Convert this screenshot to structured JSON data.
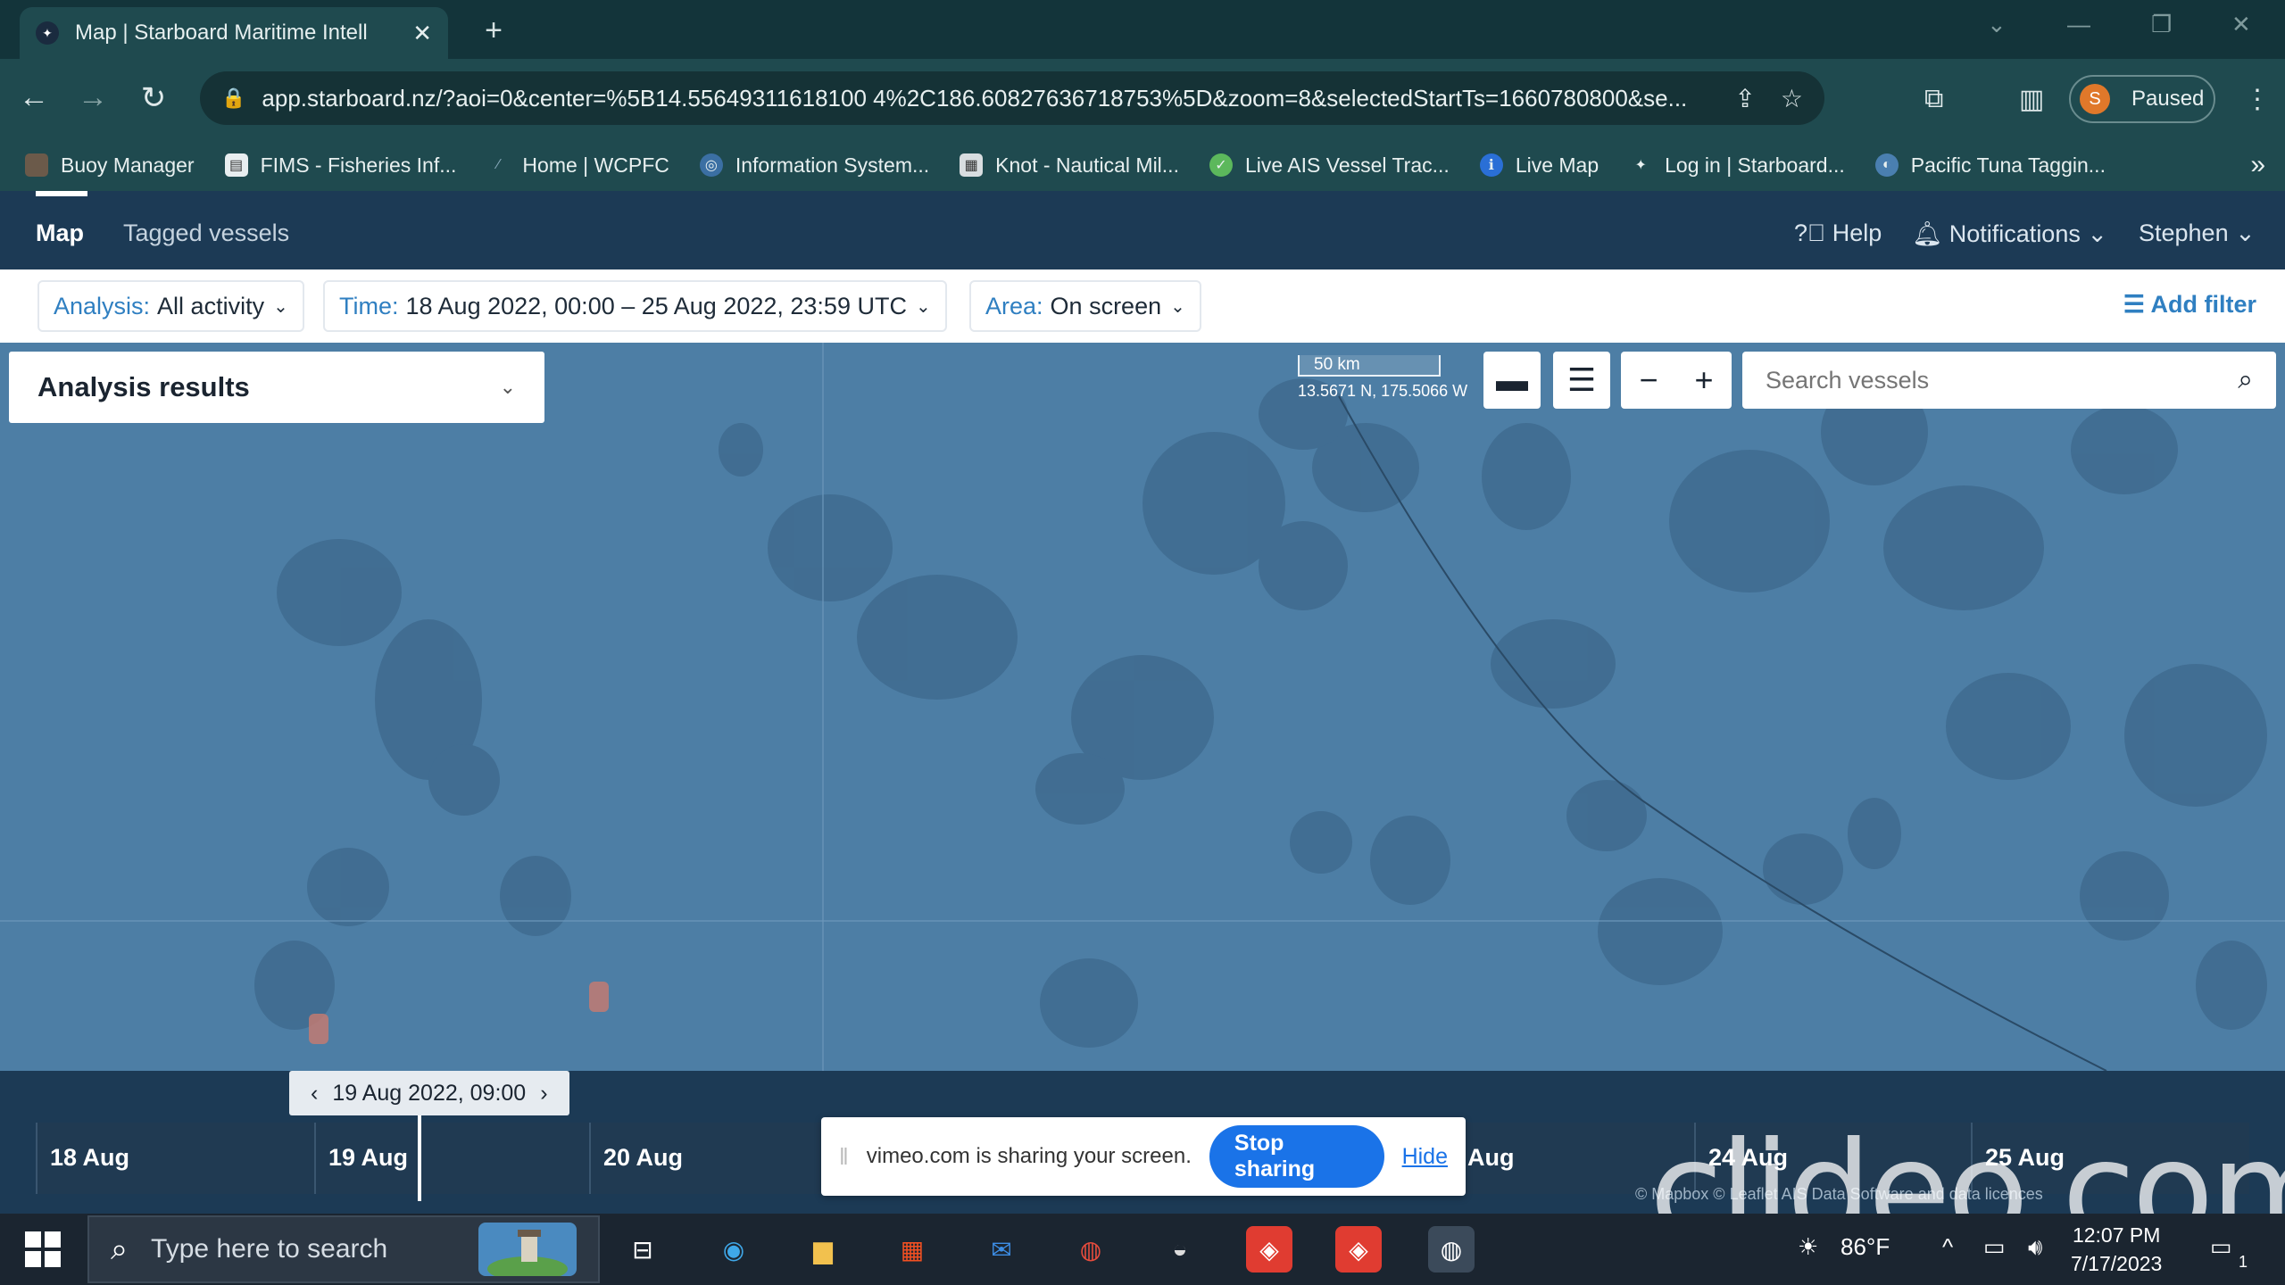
{
  "browser": {
    "tab_title": "Map | Starboard Maritime Intell",
    "url": "app.starboard.nz/?aoi=0&center=%5B14.55649311618100 4%2C186.60827636718753%5D&zoom=8&selectedStartTs=1660780800&se...",
    "profile_label": "Paused",
    "profile_initial": "S",
    "bookmarks": [
      "Buoy Manager",
      "FIMS - Fisheries Inf...",
      "Home | WCPFC",
      "Information System...",
      "Knot - Nautical Mil...",
      "Live AIS Vessel Trac...",
      "Live Map",
      "Log in | Starboard...",
      "Pacific Tuna Taggin..."
    ]
  },
  "app": {
    "nav": {
      "map": "Map",
      "tagged": "Tagged vessels"
    },
    "header_right": {
      "help": "Help",
      "notifications": "Notifications",
      "user": "Stephen"
    },
    "filters": {
      "analysis_key": "Analysis:",
      "analysis_val": "All activity",
      "time_key": "Time:",
      "time_val": "18 Aug 2022, 00:00 – 25 Aug 2022, 23:59 UTC",
      "area_key": "Area:",
      "area_val": "On screen",
      "add_filter": "Add filter"
    },
    "panel_title": "Analysis results",
    "scale_label": "50 km",
    "coord_readout": "13.5671 N, 175.5066 W",
    "search_placeholder": "Search vessels",
    "timeline": {
      "selected": "19 Aug 2022, 09:00",
      "days": [
        "18 Aug",
        "19 Aug",
        "20 Aug",
        "Aug",
        "24 Aug",
        "25 Aug"
      ],
      "credits": "© Mapbox  © Leaflet  AIS Data  Software and data licences"
    }
  },
  "share": {
    "message": "vimeo.com is sharing your screen.",
    "stop": "Stop sharing",
    "hide": "Hide"
  },
  "watermark": "clideo.com",
  "taskbar": {
    "search_placeholder": "Type here to search",
    "weather": "86°F",
    "time": "12:07 PM",
    "date": "7/17/2023",
    "notif_count": "1"
  }
}
